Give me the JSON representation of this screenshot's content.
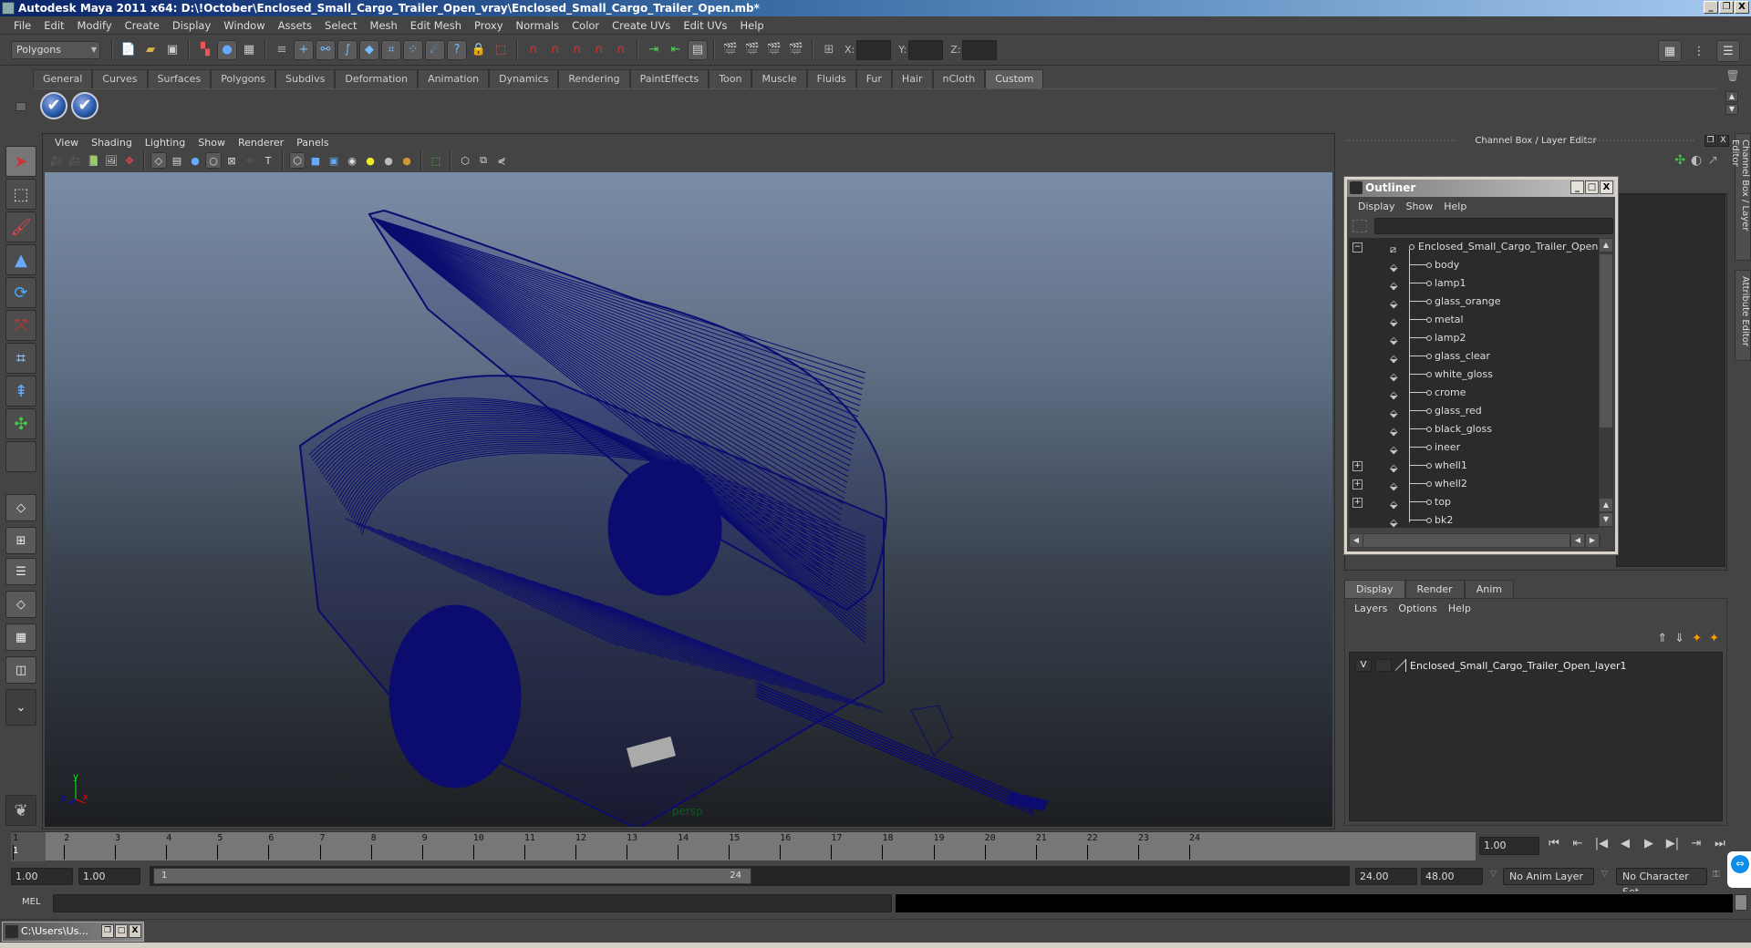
{
  "window": {
    "title": "Autodesk Maya 2011 x64: D:\\!October\\Enclosed_Small_Cargo_Trailer_Open_vray\\Enclosed_Small_Cargo_Trailer_Open.mb*",
    "buttons": {
      "minimize": "_",
      "restore": "❐",
      "close": "X"
    }
  },
  "menubar": [
    "File",
    "Edit",
    "Modify",
    "Create",
    "Display",
    "Window",
    "Assets",
    "Select",
    "Mesh",
    "Edit Mesh",
    "Proxy",
    "Normals",
    "Color",
    "Create UVs",
    "Edit UVs",
    "Help"
  ],
  "statusline": {
    "mode": "Polygons",
    "icons": [
      "new-scene-icon",
      "open-scene-icon",
      "save-scene-icon",
      "select-by-hierarchy-icon",
      "select-by-object-icon",
      "select-by-component-icon",
      "mask-icon",
      "select-handles-icon",
      "select-joints-icon",
      "select-curves-icon",
      "select-surfaces-icon",
      "select-deformations-icon",
      "select-dynamics-icon",
      "select-rendering-icon",
      "select-misc-icon",
      "lock-selection-icon",
      "highlight-selection-icon",
      "snap-grid-icon",
      "snap-curve-icon",
      "snap-point-icon",
      "snap-view-plane-icon",
      "make-live-icon",
      "input-ops-icon",
      "output-ops-icon",
      "construction-history-icon",
      "render-view-icon",
      "render-current-icon",
      "ipr-render-icon",
      "render-settings-icon",
      "transform-field-icon"
    ],
    "x_label": "X:",
    "y_label": "Y:",
    "z_label": "Z:",
    "x_value": "",
    "y_value": "",
    "z_value": ""
  },
  "shelf": {
    "tabs": [
      "General",
      "Curves",
      "Surfaces",
      "Polygons",
      "Subdivs",
      "Deformation",
      "Animation",
      "Dynamics",
      "Rendering",
      "PaintEffects",
      "Toon",
      "Muscle",
      "Fluids",
      "Fur",
      "Hair",
      "nCloth",
      "Custom"
    ],
    "active_tab": "Custom",
    "buttons": [
      "✔",
      "✔"
    ]
  },
  "toolbox": {
    "tools": [
      {
        "name": "select-tool",
        "glyph": "➤"
      },
      {
        "name": "lasso-tool",
        "glyph": "⬚"
      },
      {
        "name": "paint-select-tool",
        "glyph": "🖌"
      },
      {
        "name": "move-tool",
        "glyph": "▲"
      },
      {
        "name": "rotate-tool",
        "glyph": "⟳"
      },
      {
        "name": "scale-tool",
        "glyph": "⤧"
      },
      {
        "name": "universal-manipulator-tool",
        "glyph": "⌗"
      },
      {
        "name": "soft-modification-tool",
        "glyph": "⇞"
      },
      {
        "name": "show-manipulator-tool",
        "glyph": "✣"
      },
      {
        "name": "last-tool-used",
        "glyph": ""
      }
    ],
    "layouts": [
      "◇",
      "⊞",
      "☰",
      "◇",
      "▦",
      "◫",
      "⌄"
    ]
  },
  "viewport": {
    "menu": [
      "View",
      "Shading",
      "Lighting",
      "Show",
      "Renderer",
      "Panels"
    ],
    "camera": "persp",
    "axis": {
      "x": "x",
      "y": "y",
      "z": "z"
    },
    "wire_color": "#0c0c70"
  },
  "channelbox": {
    "title": "Channel Box / Layer Editor"
  },
  "outliner": {
    "title": "Outliner",
    "menu": [
      "Display",
      "Show",
      "Help"
    ],
    "search_value": "",
    "root": "Enclosed_Small_Cargo_Trailer_Open",
    "items": [
      {
        "name": "body",
        "expandable": false
      },
      {
        "name": "lamp1",
        "expandable": false
      },
      {
        "name": "glass_orange",
        "expandable": false
      },
      {
        "name": "metal",
        "expandable": false
      },
      {
        "name": "lamp2",
        "expandable": false
      },
      {
        "name": "glass_clear",
        "expandable": false
      },
      {
        "name": "white_gloss",
        "expandable": false
      },
      {
        "name": "crome",
        "expandable": false
      },
      {
        "name": "glass_red",
        "expandable": false
      },
      {
        "name": "black_gloss",
        "expandable": false
      },
      {
        "name": "ineer",
        "expandable": false
      },
      {
        "name": "whell1",
        "expandable": true
      },
      {
        "name": "whell2",
        "expandable": true
      },
      {
        "name": "top",
        "expandable": true
      },
      {
        "name": "bk2",
        "expandable": false
      }
    ]
  },
  "layer_editor": {
    "tabs": [
      "Display",
      "Render",
      "Anim"
    ],
    "active_tab": "Display",
    "menu": [
      "Layers",
      "Options",
      "Help"
    ],
    "layers": [
      {
        "visible": "V",
        "name": "Enclosed_Small_Cargo_Trailer_Open_layer1"
      }
    ]
  },
  "side_tabs": [
    "Channel Box / Layer Editor",
    "Attribute Editor"
  ],
  "timeline": {
    "ticks": [
      1,
      2,
      3,
      4,
      5,
      6,
      7,
      8,
      9,
      10,
      11,
      12,
      13,
      14,
      15,
      16,
      17,
      18,
      19,
      20,
      21,
      22,
      23,
      24
    ],
    "current_frame": "1",
    "current_time": "1.00",
    "playback_buttons": [
      "⏮",
      "⇤",
      "|◀",
      "◀",
      "▶",
      "▶|",
      "⇥",
      "⏭"
    ]
  },
  "range": {
    "start_time": "1.00",
    "playback_start": "1.00",
    "slider_start": "1",
    "slider_end": "24",
    "playback_end": "24.00",
    "end_time": "48.00",
    "anim_layer": "No Anim Layer",
    "character_set": "No Character Set"
  },
  "command_line": {
    "label": "MEL",
    "input": "",
    "output": ""
  },
  "taskbar": {
    "minimized_window": "C:\\Users\\Us..."
  }
}
